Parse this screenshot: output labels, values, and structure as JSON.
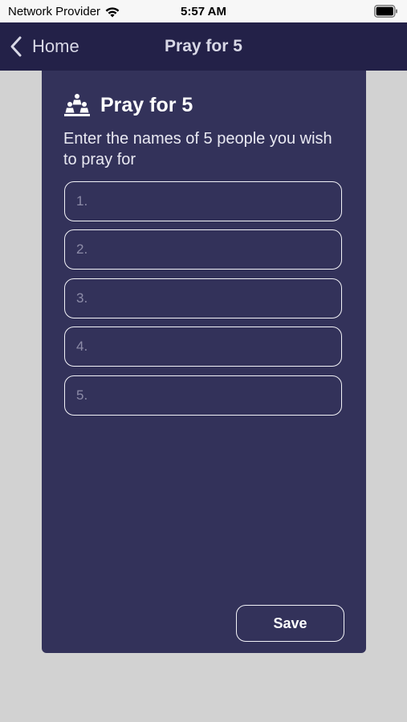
{
  "status_bar": {
    "carrier": "Network Provider",
    "time": "5:57 AM",
    "icons": [
      "wifi-icon",
      "battery-icon"
    ]
  },
  "nav": {
    "back_label": "Home",
    "title": "Pray for 5",
    "back_icon": "chevron-left-icon"
  },
  "card": {
    "icon": "people-group-icon",
    "title": "Pray for 5",
    "subtitle": "Enter the names of 5 people you wish to pray for",
    "fields": [
      {
        "placeholder": "1.",
        "value": ""
      },
      {
        "placeholder": "2.",
        "value": ""
      },
      {
        "placeholder": "3.",
        "value": ""
      },
      {
        "placeholder": "4.",
        "value": ""
      },
      {
        "placeholder": "5.",
        "value": ""
      }
    ],
    "save_label": "Save"
  },
  "colors": {
    "nav_background": "#232148",
    "card_background": "#33325a",
    "page_background": "#d2d2d2"
  }
}
